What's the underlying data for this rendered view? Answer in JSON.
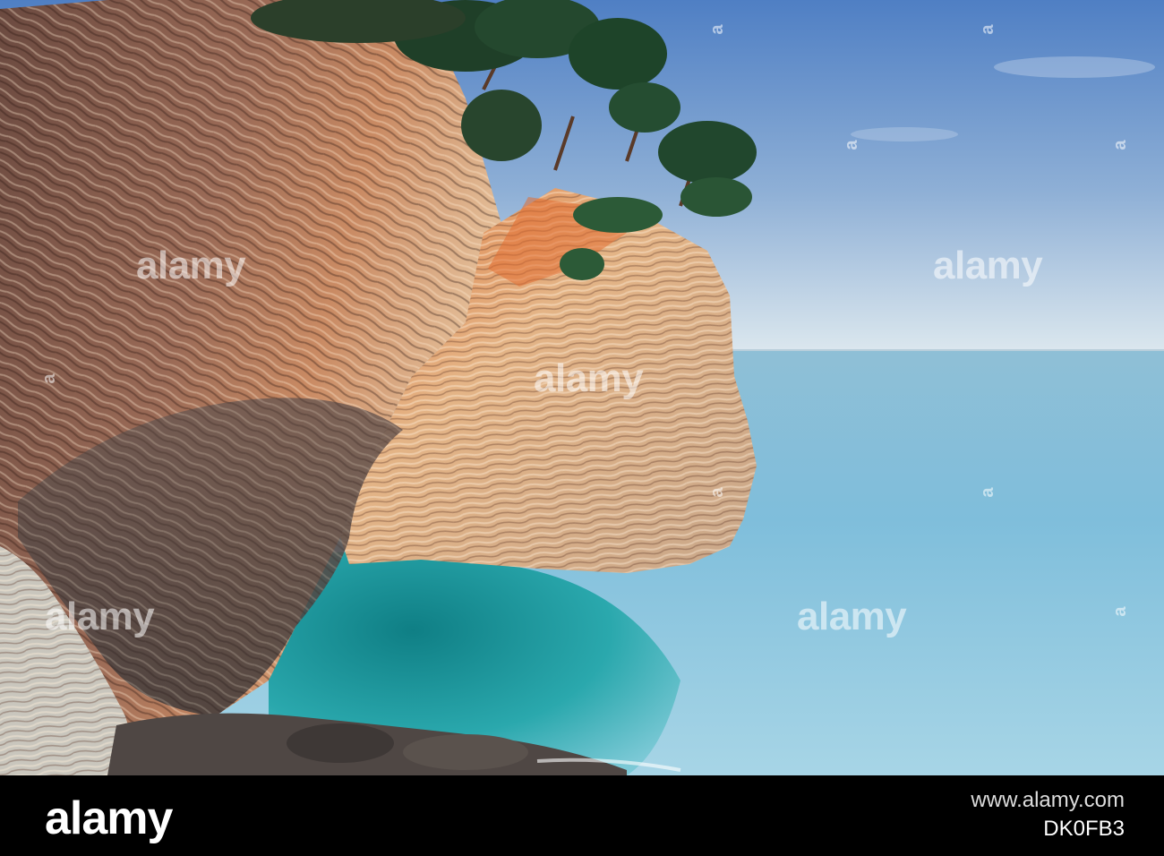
{
  "photo": {
    "subject": "",
    "colors": {
      "sky_top": "#5b86c6",
      "sky_horizon": "#d9e6ef",
      "sea": "#8ec6dd",
      "sea_deep": "#5fa9c9",
      "lagoon": "#1f9ea6",
      "rock_light": "#d9ab82",
      "rock_mid": "#a8705a",
      "rock_dark": "#5a3f3a",
      "foliage": "#1f4a2c"
    }
  },
  "watermark": {
    "text": "alamy",
    "vertical_text": "a"
  },
  "footer": {
    "logo": "alamy",
    "image_id": "DK0FB3",
    "site": "www.alamy.com"
  }
}
